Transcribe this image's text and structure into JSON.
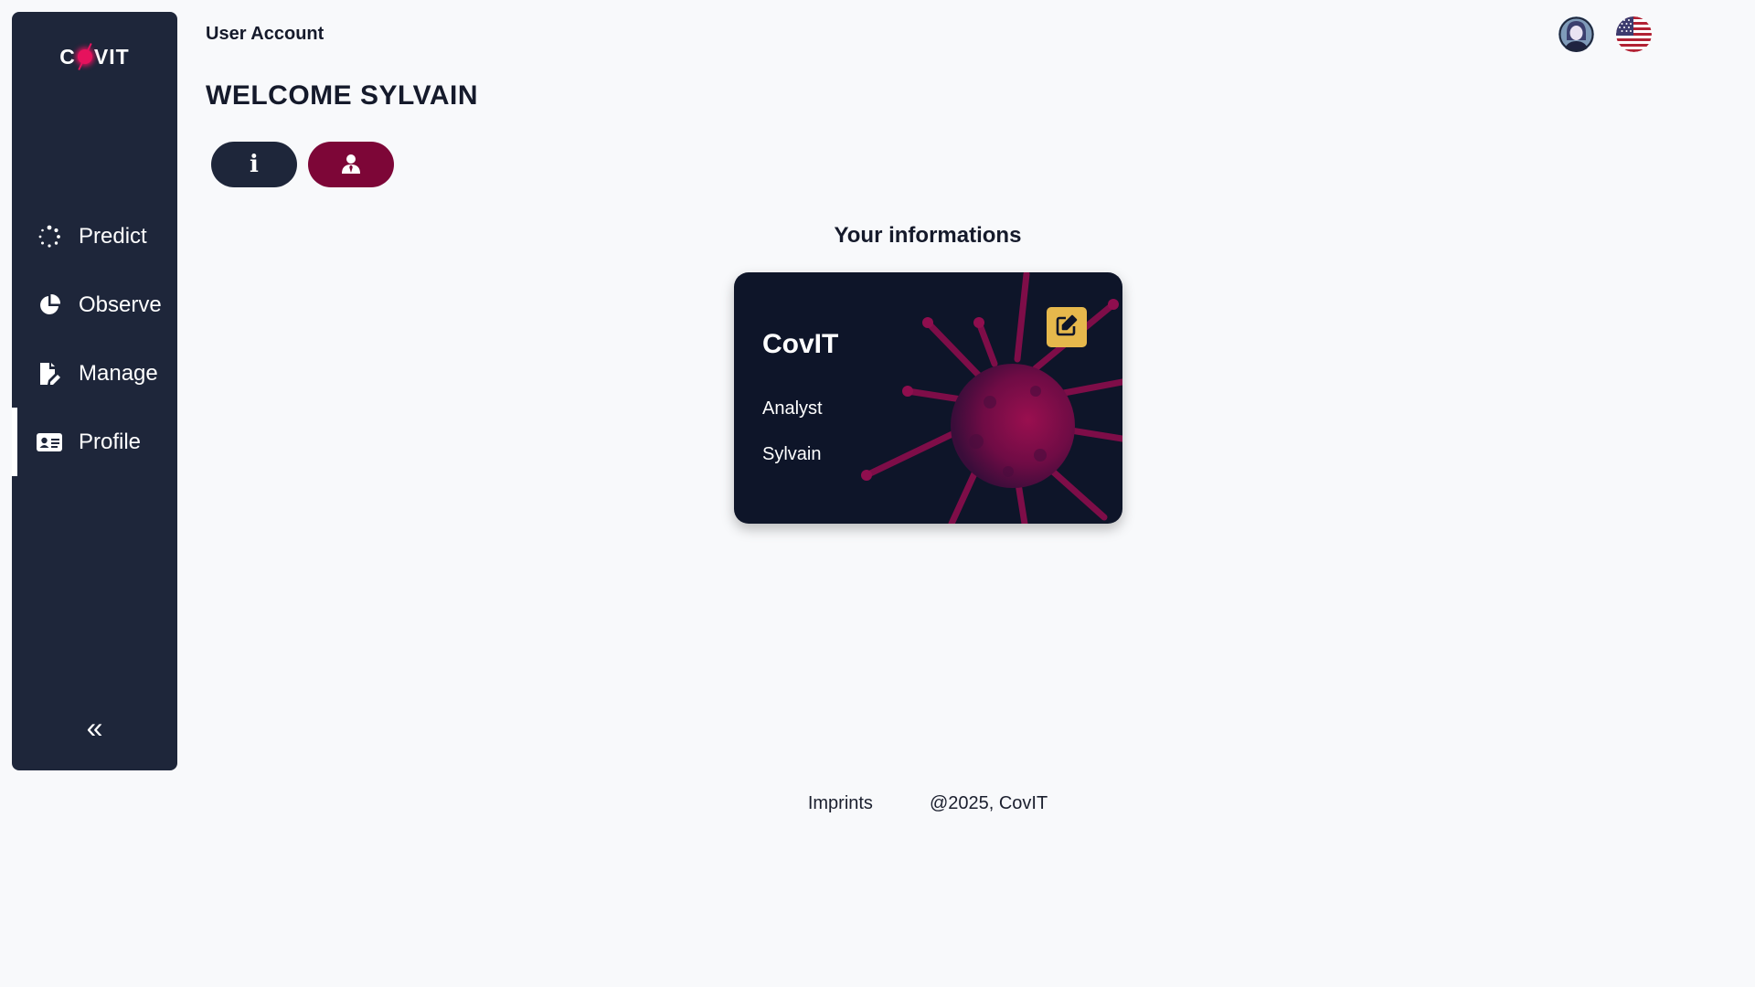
{
  "app": {
    "logo_text_left": "C",
    "logo_text_right": "VIT"
  },
  "sidebar": {
    "items": [
      {
        "label": "Predict",
        "icon": "spinner-dots-icon"
      },
      {
        "label": "Observe",
        "icon": "pie-chart-icon"
      },
      {
        "label": "Manage",
        "icon": "file-edit-icon"
      },
      {
        "label": "Profile",
        "icon": "id-card-icon",
        "active": true
      }
    ],
    "collapse_glyph": "«"
  },
  "header": {
    "breadcrumb": "User Account",
    "welcome": "WELCOME SYLVAIN"
  },
  "tabs": [
    {
      "glyph": "i",
      "icon": "info-icon",
      "active": false
    },
    {
      "icon": "user-tie-icon",
      "active": true
    }
  ],
  "main": {
    "section_title": "Your informations",
    "card": {
      "brand": "CovIT",
      "role": "Analyst",
      "name": "Sylvain",
      "edit_icon": "edit-icon"
    }
  },
  "topbar": {
    "avatar_icon": "avatar-icon",
    "language_icon": "us-flag-icon"
  },
  "footer": {
    "imprints": "Imprints",
    "copyright": "@2025, CovIT"
  },
  "colors": {
    "sidebar": "#1e263a",
    "accent": "#7d0637",
    "edit": "#e6b84c",
    "card": "#0e1529"
  }
}
